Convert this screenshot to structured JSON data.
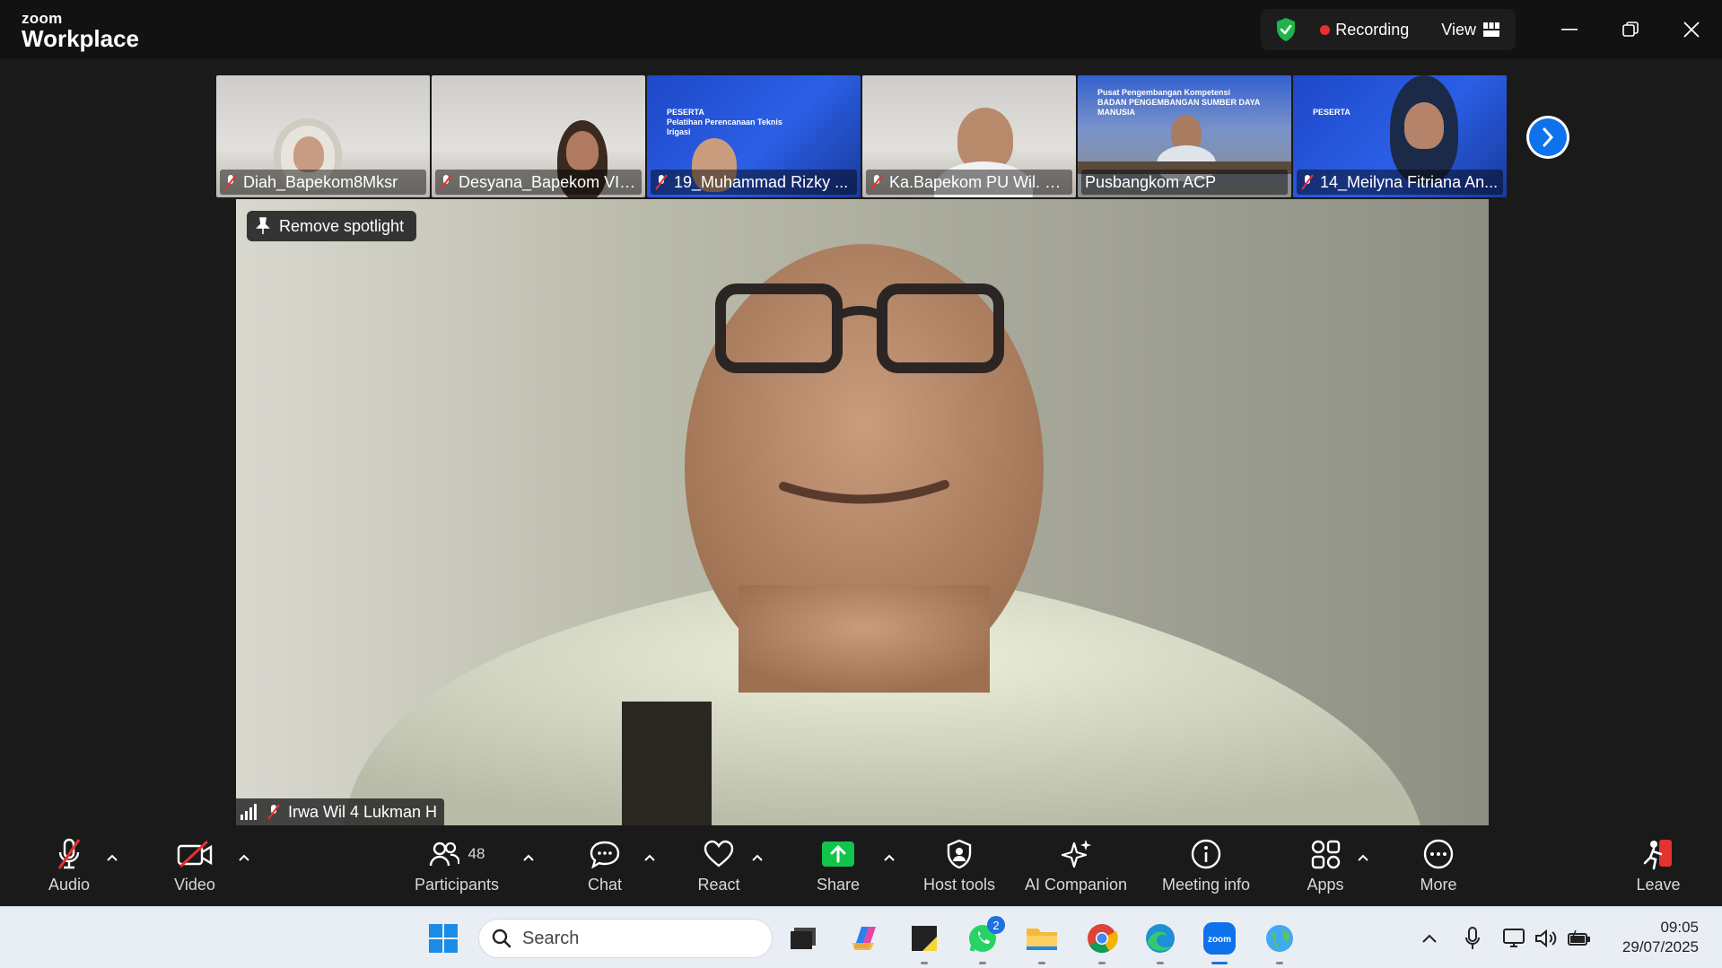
{
  "app": {
    "brand_small": "zoom",
    "brand_large": "Workplace"
  },
  "titlebar": {
    "recording_label": "Recording",
    "view_label": "View"
  },
  "participants_strip": [
    {
      "name": "Diah_Bapekom8Mksr",
      "muted": true
    },
    {
      "name": "Desyana_Bapekom VIII...",
      "muted": true
    },
    {
      "name": "19_Muhammad Rizky ...",
      "muted": true
    },
    {
      "name": "Ka.Bapekom PU Wil. VI...",
      "muted": true
    },
    {
      "name": "Pusbangkom ACP",
      "muted": false
    },
    {
      "name": "14_Meilyna Fitriana An...",
      "muted": true
    }
  ],
  "banners": {
    "peserta": "PESERTA",
    "pelatihan_irigasi": "Pelatihan Perencanaan Teknis Irigasi",
    "pusbangkom": "Pusat Pengembangan Kompetensi",
    "bpsdm": "BADAN PENGEMBANGAN SUMBER DAYA MANUSIA"
  },
  "main_video": {
    "spotlight_label": "Remove spotlight",
    "speaker_name": "Irwa Wil 4 Lukman H"
  },
  "toolbar": {
    "audio": "Audio",
    "video": "Video",
    "participants": "Participants",
    "participants_count": "48",
    "chat": "Chat",
    "react": "React",
    "share": "Share",
    "host_tools": "Host tools",
    "ai_companion": "AI Companion",
    "meeting_info": "Meeting info",
    "apps": "Apps",
    "more": "More",
    "leave": "Leave"
  },
  "taskbar": {
    "search_placeholder": "Search",
    "whatsapp_badge": "2",
    "time": "09:05",
    "date": "29/07/2025"
  },
  "colors": {
    "accent_blue": "#0e72ed",
    "share_green": "#12c44a",
    "record_red": "#e5312f",
    "shield_green": "#1fb44b"
  }
}
